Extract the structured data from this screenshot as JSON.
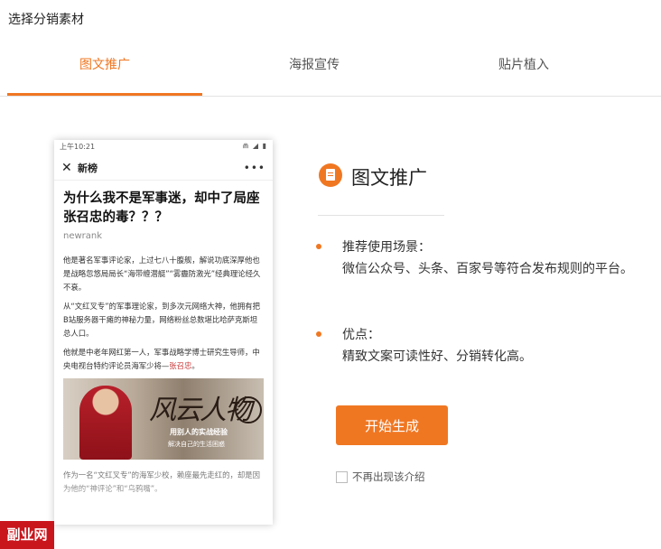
{
  "page_title": "选择分销素材",
  "tabs": [
    {
      "label": "图文推广",
      "active": true
    },
    {
      "label": "海报宣传",
      "active": false
    },
    {
      "label": "贴片植入",
      "active": false
    }
  ],
  "accent_color": "#f07722",
  "preview": {
    "status_time": "上午10:21",
    "nav_title": "新榜",
    "article_title": "为什么我不是军事迷，却中了局座张召忠的毒？？？",
    "author": "newrank",
    "paragraphs": [
      "他是著名军事评论家，上过七八十腹舰，解说功底深厚他也是战略忽悠局局长“海带缠潜艇”“雾霾防激光”经典理论经久不衰。",
      "从“文红叉专”的军事理论家，到多次元网络大神，他拥有把B站服务器干瘫的神秘力量，网络粉丝总数堪比哈萨克斯坦总人口。"
    ],
    "para3_prefix": "他就是中老年网红第一人，军事战略学博士研究生导师，中央电视台特约评论员海军少将—",
    "para3_highlight": "张召忠",
    "para3_suffix": "。",
    "image_calligraphy": "风云人物",
    "image_caption_1": "用别人的实战经验",
    "image_caption_2": "解决自己的生活困惑",
    "faded_para": "作为一名“文红叉专”的海军少校，赖座最先走红的，却是因为他的“神评论”和“乌鸦嘴”。"
  },
  "promo_type": {
    "title": "图文推广",
    "features": [
      {
        "label": "推荐使用场景：",
        "value": "微信公众号、头条、百家号等符合发布规则的平台。"
      },
      {
        "label": "优点：",
        "value": "精致文案可读性好、分销转化高。"
      }
    ]
  },
  "start_button": "开始生成",
  "dont_show_again": "不再出现该介绍",
  "watermark": "副业网"
}
